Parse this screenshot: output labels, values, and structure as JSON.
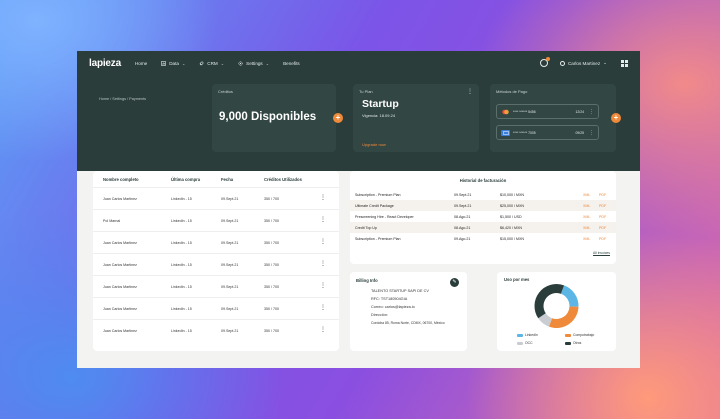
{
  "nav": {
    "logo_text": "lapieza",
    "items": [
      {
        "label": "Home",
        "has_dropdown": false,
        "icon": ""
      },
      {
        "label": "Data",
        "has_dropdown": true,
        "icon": "chart-icon"
      },
      {
        "label": "CRM",
        "has_dropdown": true,
        "icon": "rocket-icon"
      },
      {
        "label": "Settings",
        "has_dropdown": true,
        "icon": "gear-icon"
      },
      {
        "label": "Benefits",
        "has_dropdown": false,
        "icon": ""
      }
    ],
    "user_name": "Carlos Martinez",
    "accent": "#ef8a3a",
    "bg": "#2a3d3b"
  },
  "breadcrumb": "Home  /  Settings  /  Payments",
  "credits": {
    "title": "Créditos",
    "value": "9,000  Disponibles"
  },
  "plan": {
    "title": "Tu Plan",
    "name": "Startup",
    "vigencia": "Vigencia: 18.09.24",
    "upgrade": "Upgrade now"
  },
  "payment_methods": {
    "title": "Métodos de Pago",
    "cards": [
      {
        "brand": "mastercard",
        "number": "**** ****** 5456",
        "exp": "12/24"
      },
      {
        "brand": "amex",
        "number": "**** ****** 7005",
        "exp": "09/25"
      }
    ]
  },
  "credits_table": {
    "headers": [
      "Nombre completo",
      "Última compra",
      "Fecha",
      "Créditos Utilizados"
    ],
    "rows": [
      [
        "Juan Carlos Martinez",
        "LinkedIn - 15",
        "09.Sept.21",
        "350 / 700"
      ],
      [
        "Pol Marnal",
        "LinkedIn - 15",
        "09.Sept.21",
        "350 / 700"
      ],
      [
        "Juan Carlos Martinez",
        "LinkedIn - 15",
        "09.Sept.21",
        "350 / 700"
      ],
      [
        "Juan Carlos Martinez",
        "LinkedIn - 15",
        "09.Sept.21",
        "350 / 700"
      ],
      [
        "Juan Carlos Martinez",
        "LinkedIn - 15",
        "09.Sept.21",
        "350 / 700"
      ],
      [
        "Juan Carlos Martinez",
        "LinkedIn - 15",
        "09.Sept.21",
        "350 / 700"
      ],
      [
        "Juan Carlos Martinez",
        "LinkedIn - 15",
        "09.Sept.21",
        "350 / 700"
      ]
    ]
  },
  "billing_history": {
    "title": "Historial de facturación",
    "rows": [
      {
        "concept": "Subscription - Premium Plan",
        "date": "09.Sept.21",
        "amount": "$10,000 / MXN",
        "xml": "XML",
        "pdf": "PDF"
      },
      {
        "concept": "Ultimate Credit Package",
        "date": "09.Sept.21",
        "amount": "$25,000 / MXN",
        "xml": "XML",
        "pdf": "PDF"
      },
      {
        "concept": "Prescreening Hire - React Developer",
        "date": "08.Ago.21",
        "amount": "$1,500 / USD",
        "xml": "XML",
        "pdf": "PDF"
      },
      {
        "concept": "Credit Top Up",
        "date": "08.Ago.21",
        "amount": "$6,420 / MXN",
        "xml": "XML",
        "pdf": "PDF"
      },
      {
        "concept": "Subscription - Premium Plan",
        "date": "09.Ago.21",
        "amount": "$15,000 / MXN",
        "xml": "XML",
        "pdf": "PDF"
      }
    ],
    "all_link": "All invoices"
  },
  "billing_info": {
    "title": "Billing Info",
    "lines": [
      "TALENTO STARTUP SAPI DE CV",
      "RFC: TST180504GIA",
      "Correo: carlos@lapieza.io",
      "Dirección:",
      "Cordoba 85, Roma Norte, CDMX, 06700, México"
    ]
  },
  "usage": {
    "title": "Uso por mes",
    "legend": [
      {
        "label": "LinkedIn",
        "color": "#5bb6e6"
      },
      {
        "label": "Computrabajo",
        "color": "#ef8a3a"
      },
      {
        "label": "OCC",
        "color": "#c9ccd1"
      },
      {
        "label": "Otros",
        "color": "#2a3d3b"
      }
    ]
  },
  "chart_data": {
    "type": "pie",
    "title": "Uso por mes",
    "categories": [
      "LinkedIn",
      "Computrabajo",
      "OCC",
      "Otros"
    ],
    "values": [
      20,
      30,
      10,
      40
    ],
    "colors": [
      "#5bb6e6",
      "#ef8a3a",
      "#c9ccd1",
      "#2a3d3b"
    ],
    "donut": true
  }
}
